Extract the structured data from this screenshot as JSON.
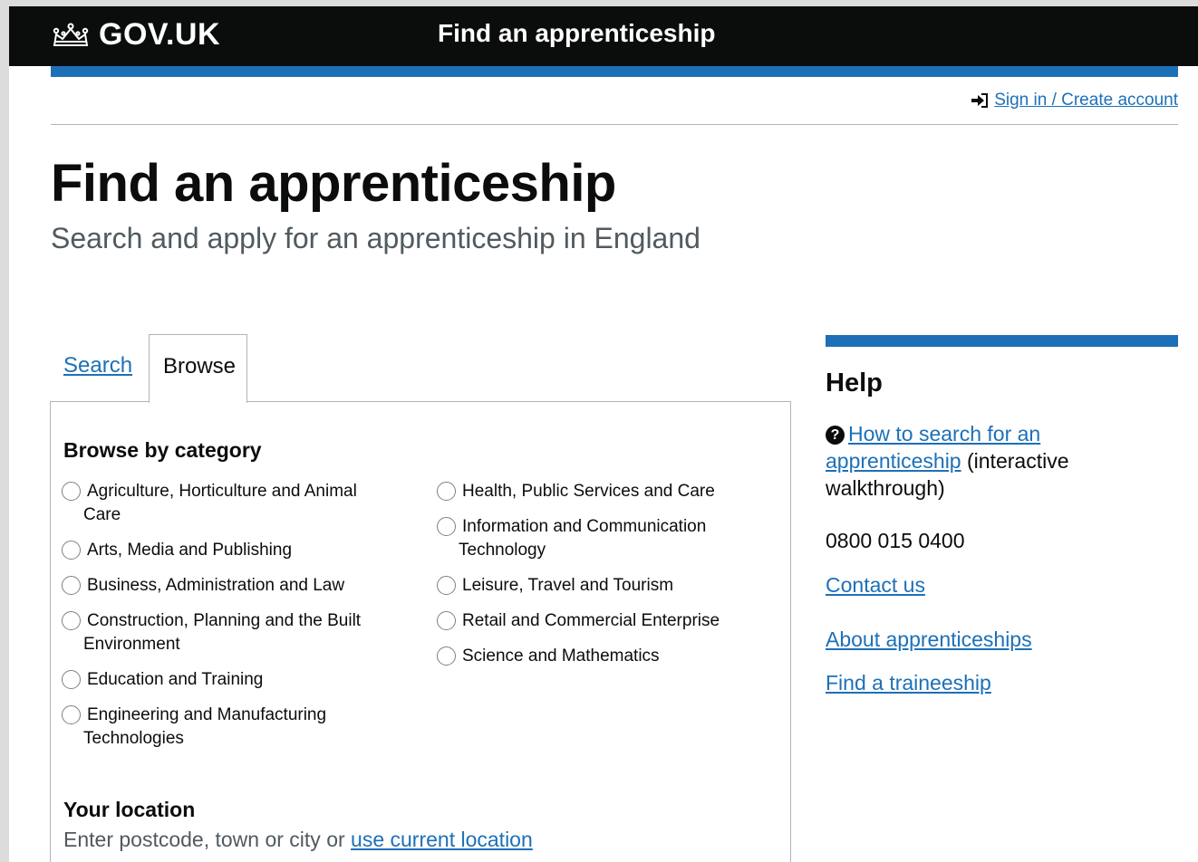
{
  "header": {
    "logo_text": "GOV.UK",
    "service_name": "Find an apprenticeship",
    "brand_color": "#1d70b8",
    "crown_icon": "crown-icon"
  },
  "account": {
    "signin_label": "Sign in / Create account",
    "signin_icon": "sign-in-icon"
  },
  "page": {
    "title": "Find an apprenticeship",
    "subtitle": "Search and apply for an apprenticeship in England"
  },
  "tabs": {
    "search": "Search",
    "browse": "Browse",
    "selected": "Browse"
  },
  "browse": {
    "heading": "Browse by category",
    "left_categories": [
      {
        "line1": "Agriculture, Horticulture and Animal",
        "line2": "Care"
      },
      {
        "line1": "Arts, Media and Publishing",
        "line2": ""
      },
      {
        "line1": "Business, Administration and Law",
        "line2": ""
      },
      {
        "line1": "Construction, Planning and the Built",
        "line2": "Environment"
      },
      {
        "line1": "Education and Training",
        "line2": ""
      },
      {
        "line1": "Engineering and Manufacturing",
        "line2": "Technologies"
      }
    ],
    "right_categories": [
      {
        "line1": "Health, Public Services and Care",
        "line2": ""
      },
      {
        "line1": "Information and Communication",
        "line2": "Technology"
      },
      {
        "line1": "Leisure, Travel and Tourism",
        "line2": ""
      },
      {
        "line1": "Retail and Commercial Enterprise",
        "line2": ""
      },
      {
        "line1": "Science and Mathematics",
        "line2": ""
      }
    ],
    "location_heading": "Your location",
    "location_hint": "Enter postcode, town or city or ",
    "location_link": "use current location"
  },
  "help": {
    "title": "Help",
    "walkthrough_link": "How to search for an apprenticeship",
    "walkthrough_suffix": " (interactive walkthrough)",
    "phone": "0800 015 0400",
    "contact_link": "Contact us",
    "about_link": "About apprenticeships",
    "traineeship_link": "Find a traineeship"
  }
}
